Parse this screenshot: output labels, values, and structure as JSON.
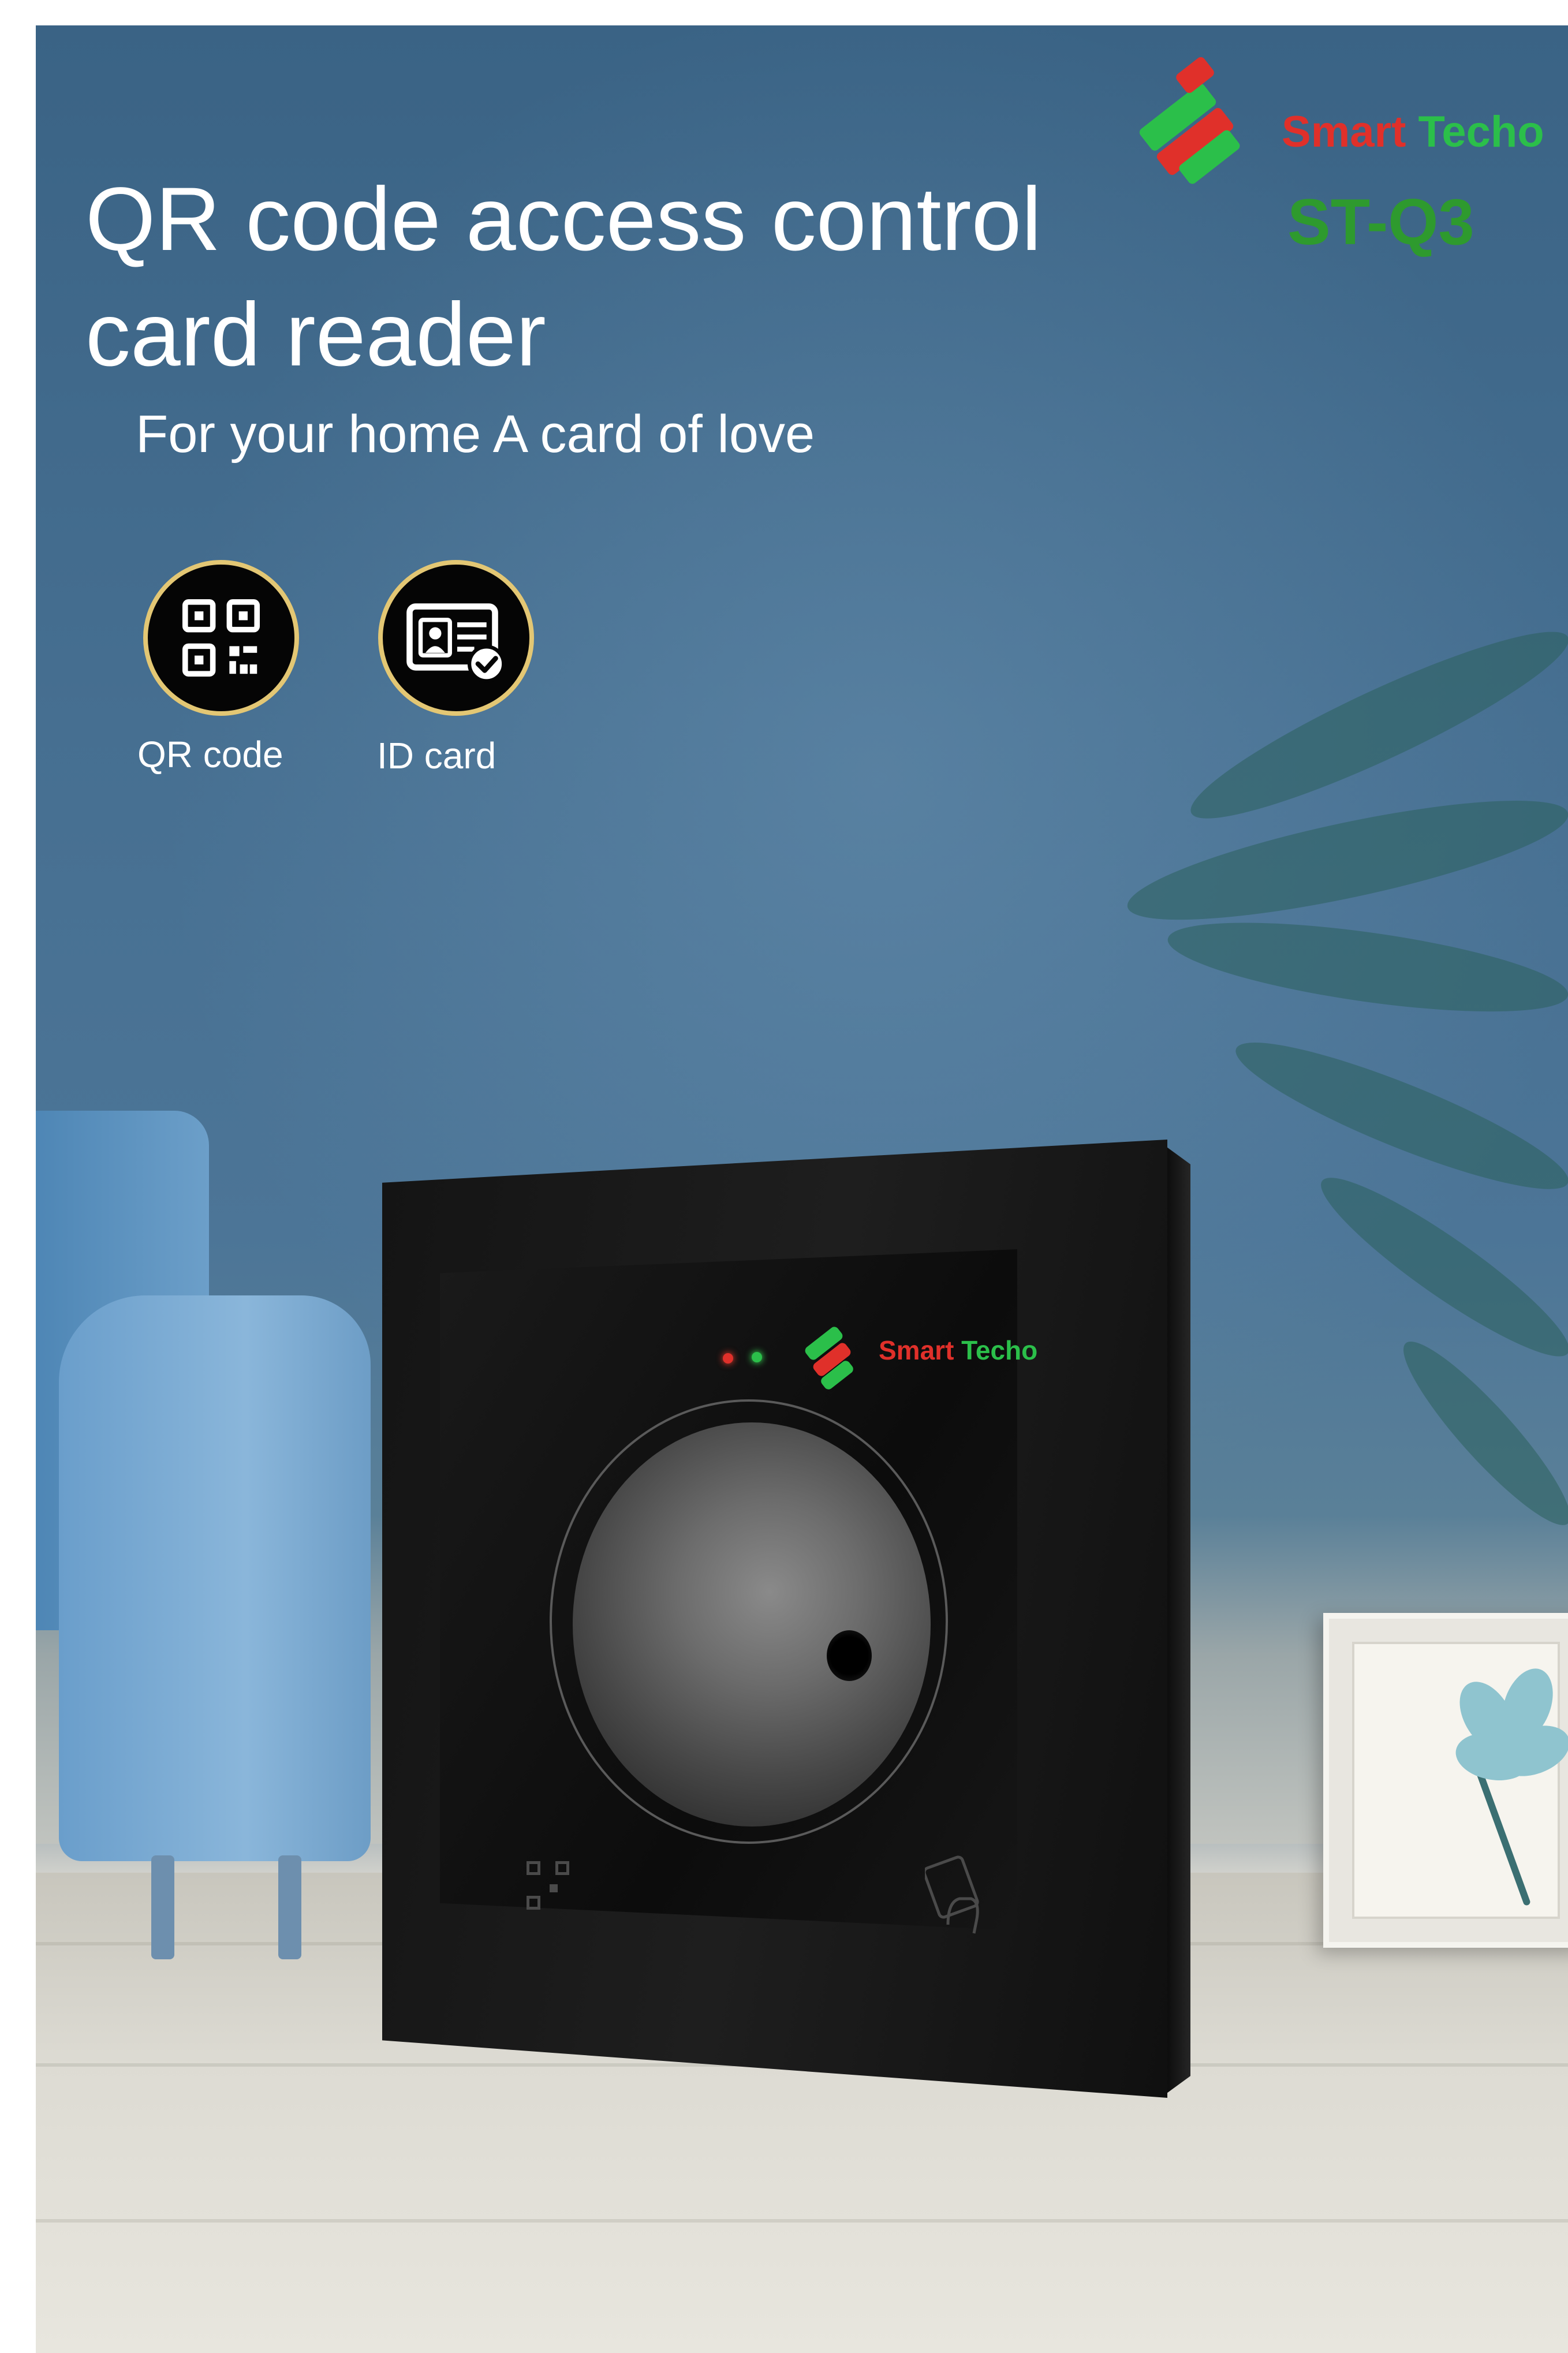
{
  "brand": {
    "name_part1": "Smart",
    "name_part2": "Techo",
    "model": "ST-Q3",
    "colors": {
      "green": "#2e9a2e",
      "red": "#e0302a",
      "badge_ring": "#e3c774"
    }
  },
  "hero": {
    "title_line1": "QR code access control",
    "title_line2": "card reader",
    "subtitle": "For your home A card of love"
  },
  "features": [
    {
      "icon": "qr-code-icon",
      "label": "QR code"
    },
    {
      "icon": "id-card-icon",
      "label": "ID card"
    }
  ],
  "device": {
    "brand_part1": "Smart",
    "brand_part2": "Techo",
    "leds": [
      "red",
      "green"
    ]
  }
}
